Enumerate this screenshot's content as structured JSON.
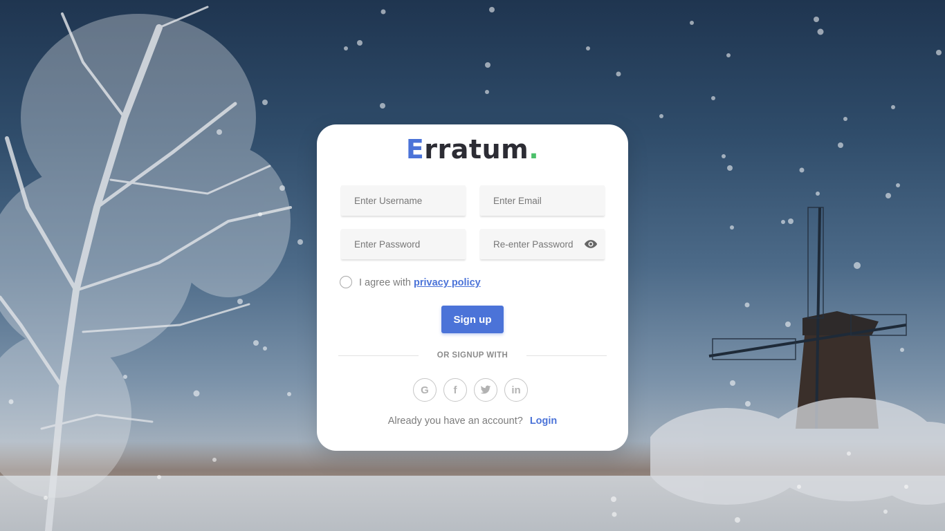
{
  "brand": {
    "initial": "E",
    "rest": "rratum",
    "dot": "."
  },
  "form": {
    "username_placeholder": "Enter Username",
    "email_placeholder": "Enter Email",
    "password_placeholder": "Enter Password",
    "repassword_placeholder": "Re-enter Password"
  },
  "agree": {
    "text": "I agree with",
    "link": "privacy policy"
  },
  "signup_button": "Sign up",
  "divider": "OR SIGNUP WITH",
  "socials": {
    "google": "G",
    "facebook": "f",
    "linkedin": "in"
  },
  "login_prompt": {
    "text": "Already you have an account?",
    "link": "Login"
  },
  "colors": {
    "accent": "#4b73d8",
    "brand_dot": "#4cc06a",
    "brand_text": "#2c2c34"
  },
  "icons": [
    "eye-icon",
    "google-icon",
    "facebook-icon",
    "twitter-icon",
    "linkedin-icon"
  ]
}
